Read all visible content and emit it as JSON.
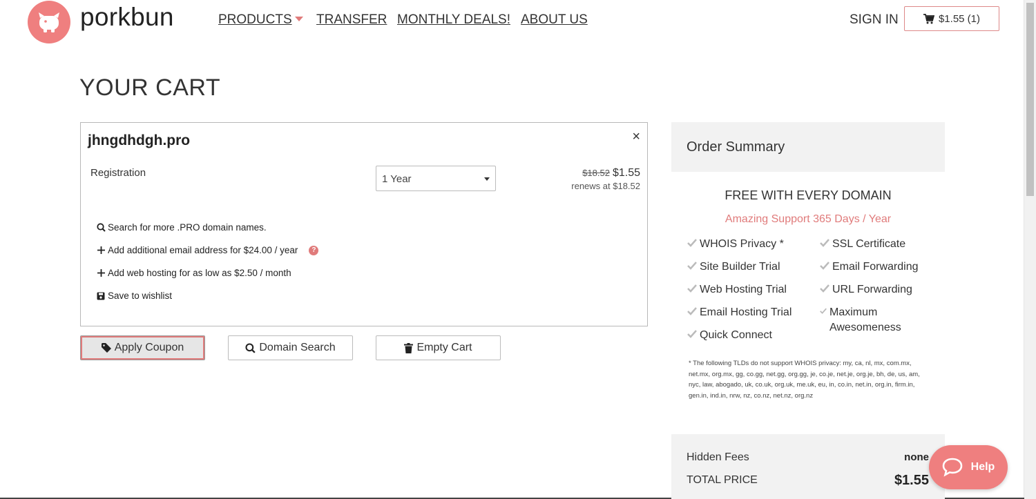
{
  "header": {
    "brand": "porkbun",
    "nav": [
      {
        "label": "PRODUCTS"
      },
      {
        "label": "TRANSFER"
      },
      {
        "label": "MONTHLY DEALS!"
      },
      {
        "label": "ABOUT US"
      }
    ],
    "sign_in": "SIGN IN",
    "cart_label": "$1.55 (1)"
  },
  "page_title": "YOUR CART",
  "cart_item": {
    "domain": "jhngdhdgh.pro",
    "close_glyph": "×",
    "registration_label": "Registration",
    "term_selected": "1 Year",
    "old_price": "$18.52",
    "new_price": "$1.55",
    "renews": "renews at $18.52",
    "options": [
      {
        "icon": "search-icon",
        "label": "Search for more .PRO domain names."
      },
      {
        "icon": "plus-icon",
        "label": "Add additional email address for $24.00 / year"
      },
      {
        "icon": "plus-icon",
        "label": "Add web hosting for as low as $2.50 / month"
      },
      {
        "icon": "save-icon",
        "label": "Save to wishlist"
      }
    ],
    "help_glyph": "?"
  },
  "actions": {
    "apply_coupon": "Apply Coupon",
    "domain_search": "Domain Search",
    "empty_cart": "Empty Cart"
  },
  "summary": {
    "title": "Order Summary",
    "free_title": "FREE WITH EVERY DOMAIN",
    "support": "Amazing Support 365 Days / Year",
    "features_left": [
      "WHOIS Privacy *",
      "Site Builder Trial",
      "Web Hosting Trial",
      "Email Hosting Trial",
      "Quick Connect"
    ],
    "features_right": [
      "SSL Certificate",
      "Email Forwarding",
      "URL Forwarding",
      "Maximum Awesomeness"
    ],
    "note": "* The following TLDs do not support WHOIS privacy: my, ca, nl, mx, com.mx, net.mx, org.mx, gg, co.gg, net.gg, org.gg, je, co.je, net.je, org.je, bh, de, us, am, nyc, law, abogado, uk, co.uk, org.uk, me.uk, eu, in, co.in, net.in, org.in, firm.in, gen.in, ind.in, nrw, nz, co.nz, net.nz, org.nz",
    "hidden_fees_label": "Hidden Fees",
    "hidden_fees_value": "none",
    "total_label": "TOTAL PRICE",
    "total_value": "$1.55"
  },
  "help_widget": {
    "label": "Help"
  },
  "colors": {
    "accent": "#ef7f7f",
    "accent_text": "#e07b7b",
    "panel": "#f2f2f2"
  }
}
